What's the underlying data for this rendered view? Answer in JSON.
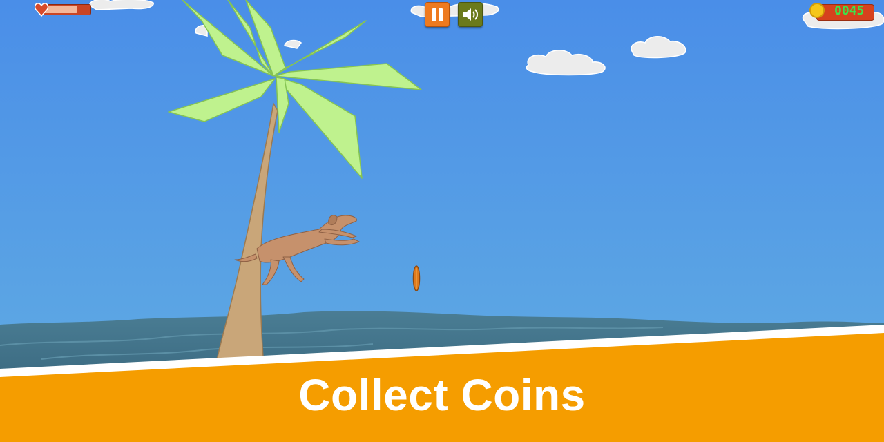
{
  "game": {
    "title": "Collect Coins",
    "coin_count": "0045",
    "health_fraction": 0.75,
    "icons": {
      "health": "heart-icon",
      "pause": "pause-icon",
      "sound": "speaker-icon",
      "coin": "coin-icon"
    }
  },
  "colors": {
    "sky_top": "#4a8ee8",
    "sky_bottom": "#62aee2",
    "sea": "#3f6f86",
    "banner": "#f59d00",
    "palm_leaf": "#bff28e",
    "trunk": "#c9a679",
    "dog": "#c6916c",
    "coin_score": "#3fe04a"
  }
}
